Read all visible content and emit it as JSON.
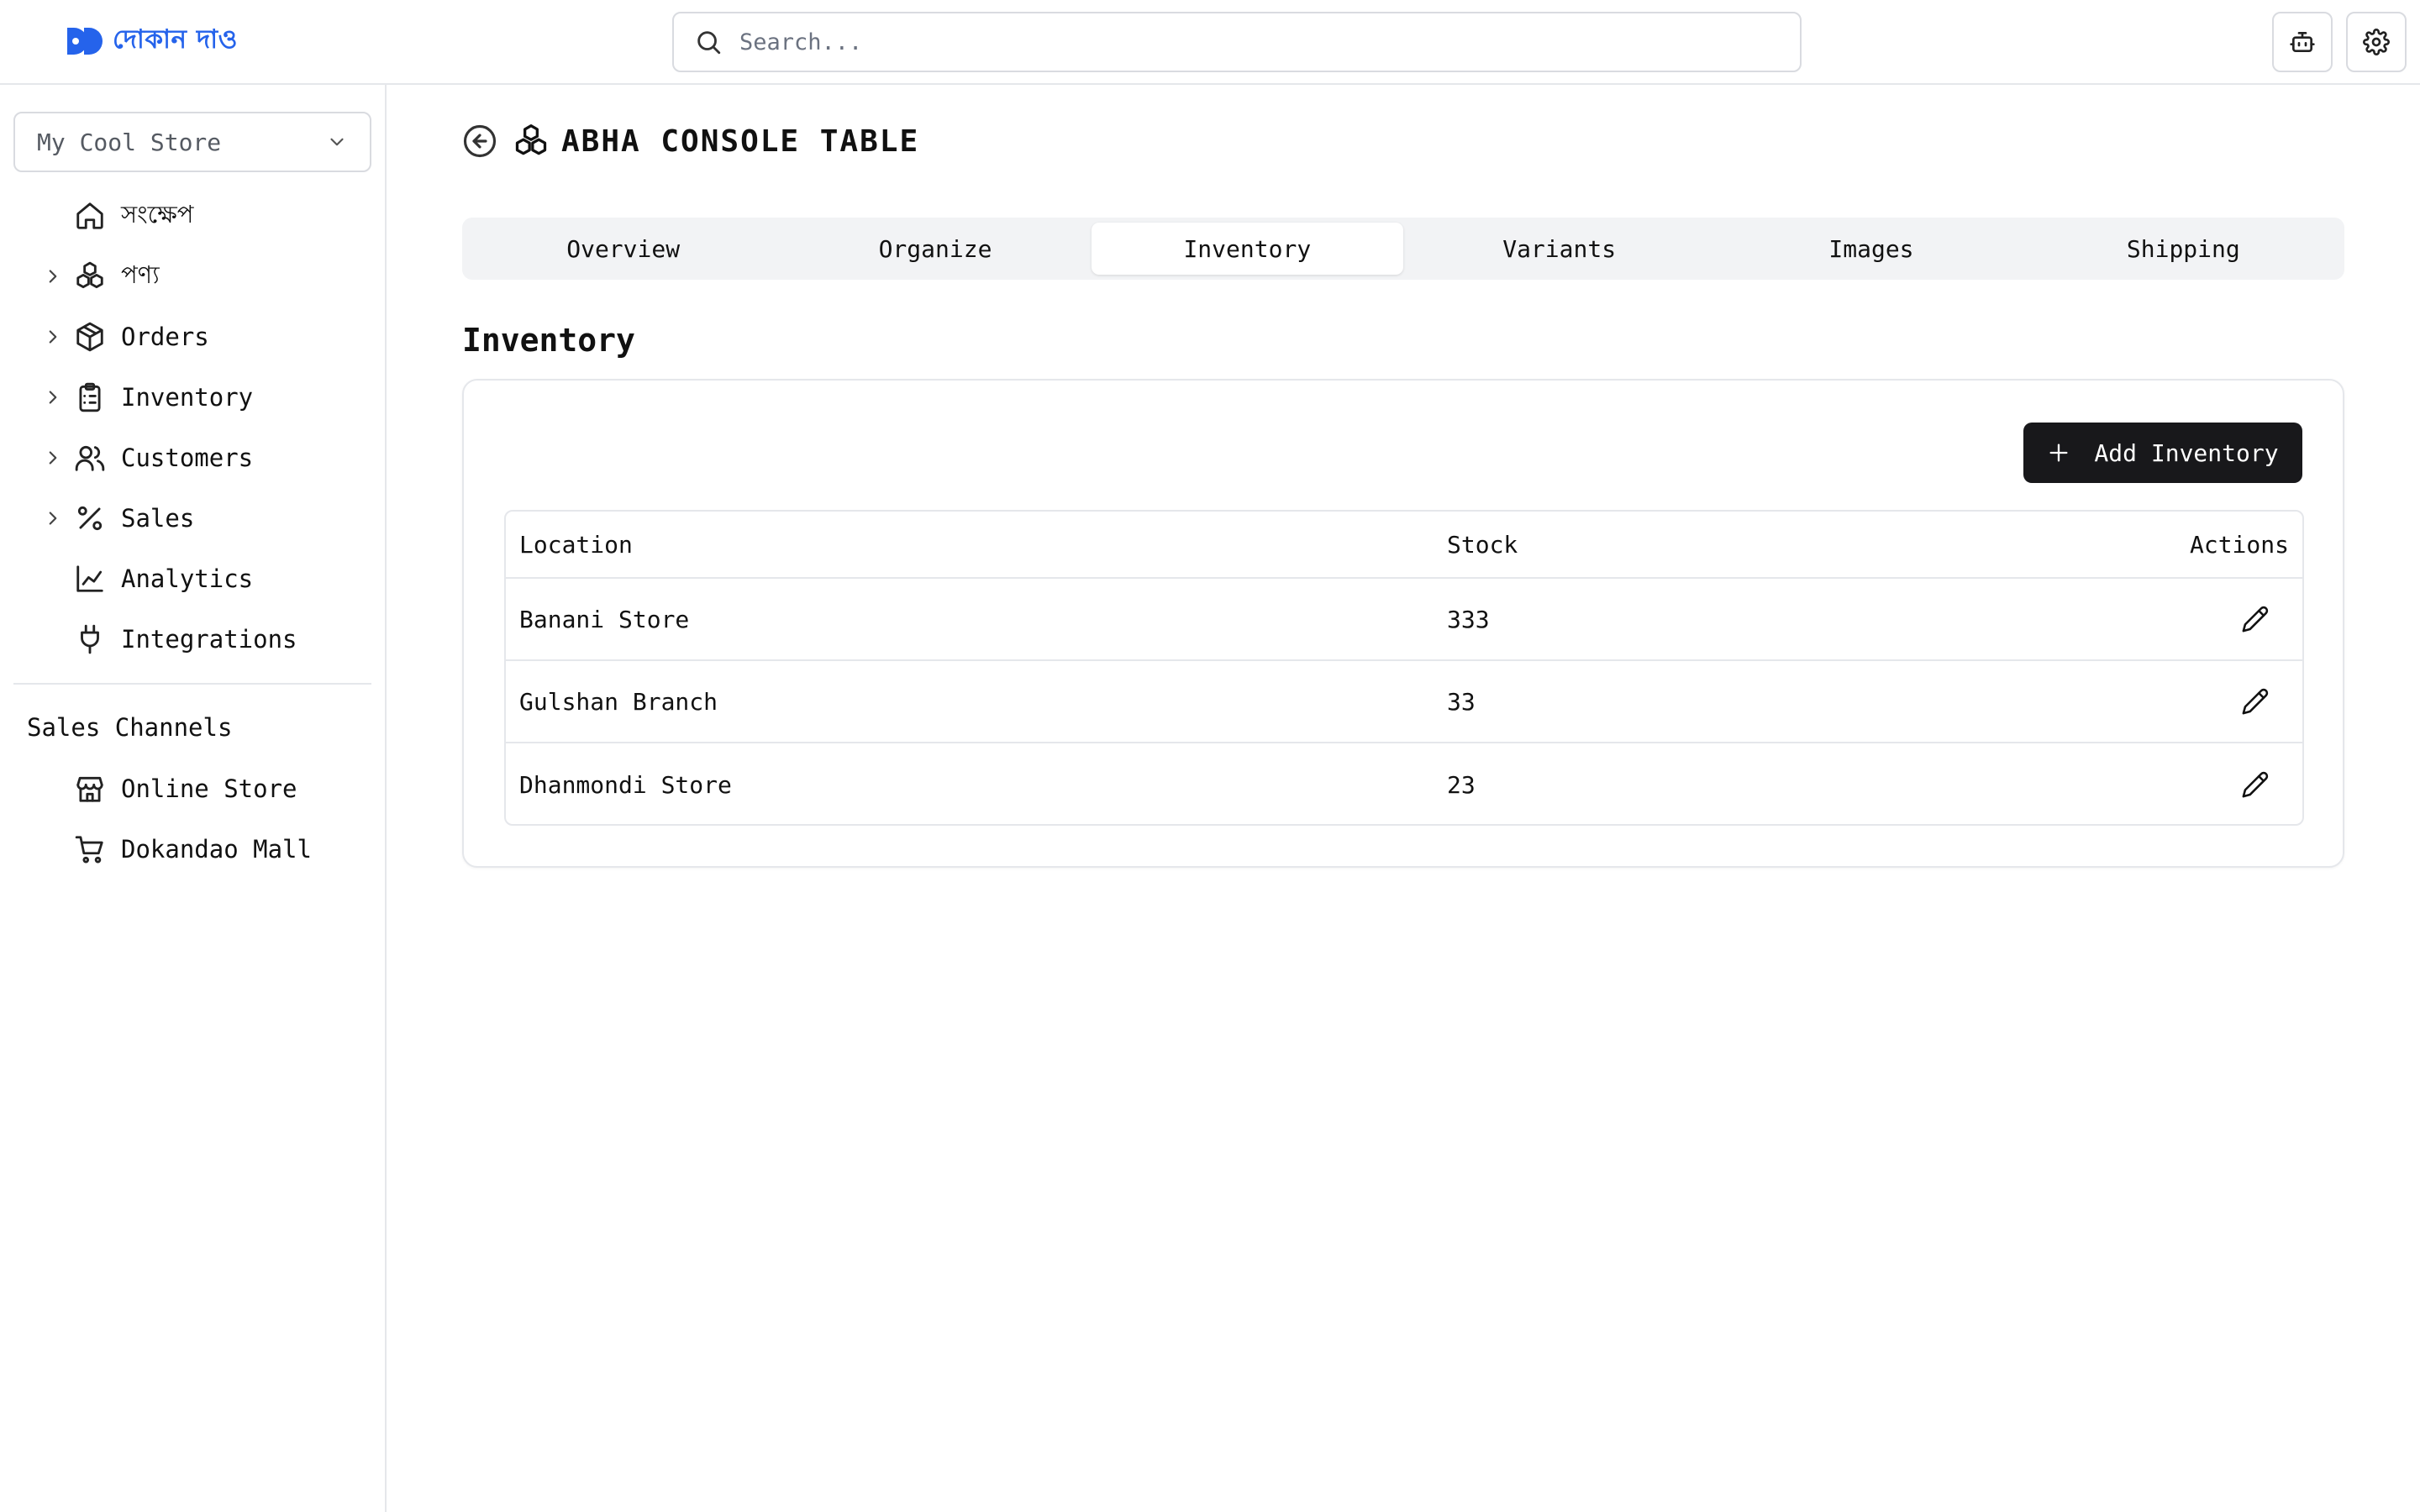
{
  "brand": {
    "name": "দোকান দাও",
    "color": "#2563eb"
  },
  "search": {
    "placeholder": "Search...",
    "value": ""
  },
  "header_actions": [
    {
      "icon": "bot-icon"
    },
    {
      "icon": "gear-icon"
    }
  ],
  "sidebar": {
    "store_selector": {
      "value": "My Cool Store"
    },
    "items": [
      {
        "label": "সংক্ষেপ",
        "icon": "home-icon",
        "expandable": false
      },
      {
        "label": "পণ্য",
        "icon": "boxes-icon",
        "expandable": true
      },
      {
        "label": "Orders",
        "icon": "package-icon",
        "expandable": true
      },
      {
        "label": "Inventory",
        "icon": "clipboard-list-icon",
        "expandable": true
      },
      {
        "label": "Customers",
        "icon": "users-icon",
        "expandable": true
      },
      {
        "label": "Sales",
        "icon": "percent-icon",
        "expandable": true
      },
      {
        "label": "Analytics",
        "icon": "line-chart-icon",
        "expandable": false
      },
      {
        "label": "Integrations",
        "icon": "plug-icon",
        "expandable": false
      }
    ],
    "sales_channels": {
      "title": "Sales Channels",
      "items": [
        {
          "label": "Online Store",
          "icon": "store-icon"
        },
        {
          "label": "Dokandao Mall",
          "icon": "shopping-cart-icon"
        }
      ]
    }
  },
  "page": {
    "title": "ABHA CONSOLE TABLE",
    "tabs": [
      {
        "label": "Overview",
        "active": false
      },
      {
        "label": "Organize",
        "active": false
      },
      {
        "label": "Inventory",
        "active": true
      },
      {
        "label": "Variants",
        "active": false
      },
      {
        "label": "Images",
        "active": false
      },
      {
        "label": "Shipping",
        "active": false
      }
    ],
    "section_title": "Inventory",
    "add_button_label": "Add Inventory",
    "table": {
      "headers": {
        "location": "Location",
        "stock": "Stock",
        "actions": "Actions"
      },
      "rows": [
        {
          "location": "Banani Store",
          "stock": "333"
        },
        {
          "location": "Gulshan Branch",
          "stock": "33"
        },
        {
          "location": "Dhanmondi Store",
          "stock": "23"
        }
      ]
    }
  }
}
